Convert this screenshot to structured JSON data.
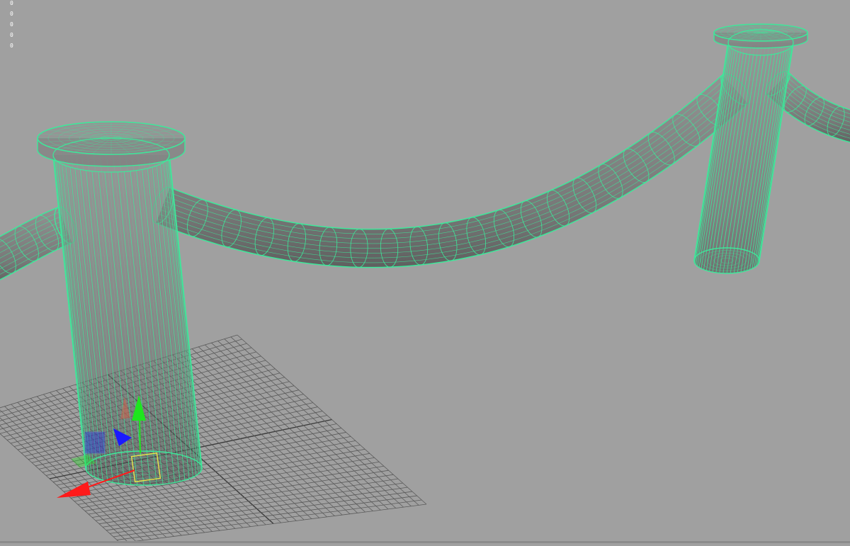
{
  "viewport": {
    "background_color": "#a0a0a0",
    "wireframe_color": "#3de89a",
    "grid_color": "#5a5a5a",
    "manipulator_colors": {
      "x": "#ff1a1a",
      "y": "#1ee61e",
      "z": "#1a1aff"
    },
    "hud_lines": [
      "0",
      "0",
      "0",
      "0",
      "0"
    ]
  },
  "objects": [
    {
      "name": "post-left",
      "type": "cylinder-wireframe",
      "selected": true
    },
    {
      "name": "post-right",
      "type": "cylinder-wireframe",
      "selected": true
    },
    {
      "name": "rope-center",
      "type": "curved-tube-wireframe",
      "selected": true
    },
    {
      "name": "rope-left",
      "type": "curved-tube-wireframe",
      "selected": true
    },
    {
      "name": "rope-right",
      "type": "curved-tube-wireframe",
      "selected": true
    }
  ],
  "manipulator": {
    "type": "move-tool",
    "icon": "move-manipulator-icon"
  }
}
